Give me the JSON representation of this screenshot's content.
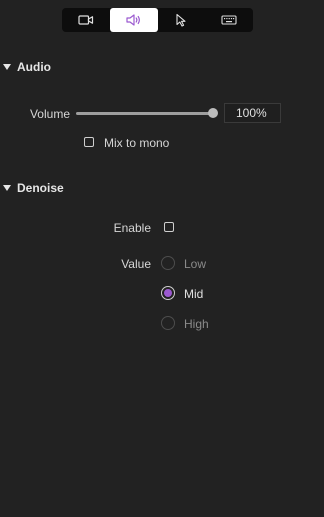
{
  "tabs": [
    {
      "icon": "video-icon",
      "active": false
    },
    {
      "icon": "speaker-icon",
      "active": true
    },
    {
      "icon": "cursor-icon",
      "active": false
    },
    {
      "icon": "keyboard-icon",
      "active": false
    }
  ],
  "colors": {
    "accent": "#9b59d0",
    "background": "#222222"
  },
  "audio": {
    "title": "Audio",
    "volume_label": "Volume",
    "volume_value": "100%",
    "volume_level": 1.0,
    "mix_to_mono_label": "Mix to mono",
    "mix_to_mono_checked": false
  },
  "denoise": {
    "title": "Denoise",
    "enable_label": "Enable",
    "enable_checked": false,
    "value_label": "Value",
    "options": [
      {
        "label": "Low",
        "selected": false
      },
      {
        "label": "Mid",
        "selected": true
      },
      {
        "label": "High",
        "selected": false
      }
    ]
  }
}
